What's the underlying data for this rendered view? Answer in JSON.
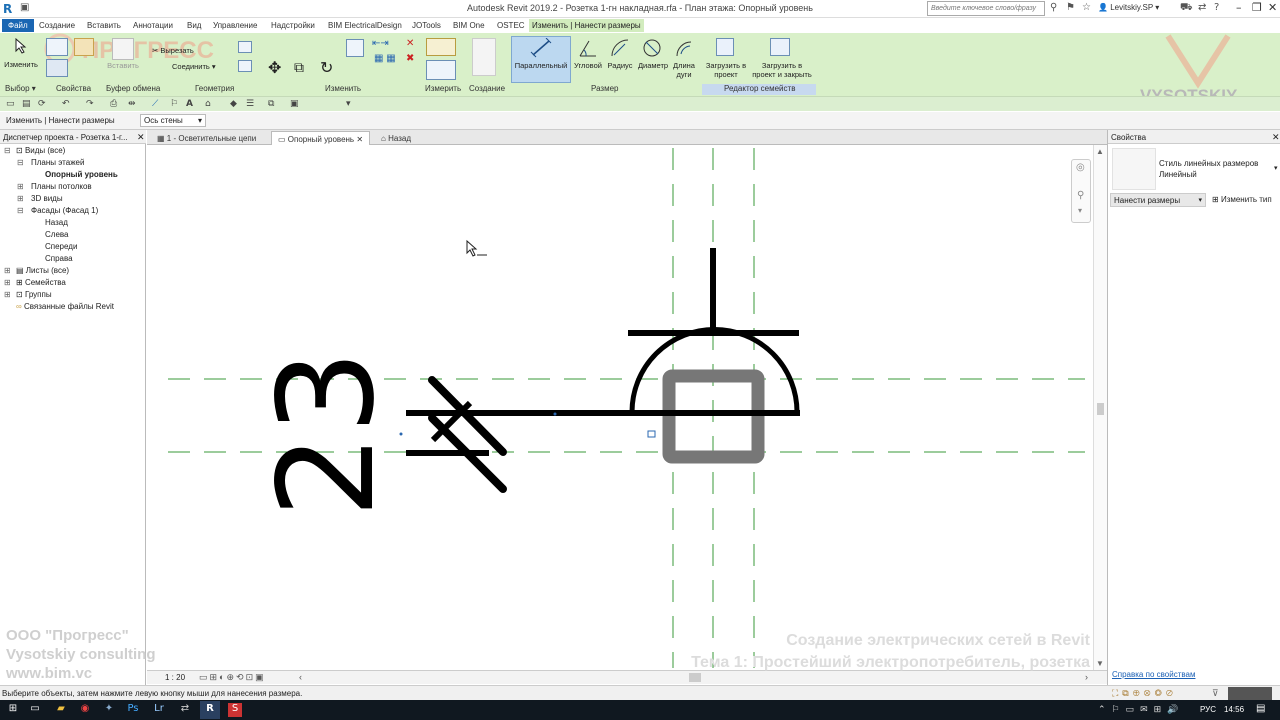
{
  "app": {
    "window_title": "Autodesk Revit 2019.2 - Розетка 1-гн накладная.rfa - План этажа: Опорный уровень",
    "search_placeholder": "Введите ключевое слово/фразу",
    "user": "Levitskiy.SP"
  },
  "ribbon_tabs": [
    {
      "label": "Файл"
    },
    {
      "label": "Создание"
    },
    {
      "label": "Вставить"
    },
    {
      "label": "Аннотации"
    },
    {
      "label": "Вид"
    },
    {
      "label": "Управление"
    },
    {
      "label": "Надстройки"
    },
    {
      "label": "BIM ElectricalDesign"
    },
    {
      "label": "JOTools"
    },
    {
      "label": "BIM One"
    },
    {
      "label": "OSTEC"
    },
    {
      "label": "Изменить | Нанести размеры"
    }
  ],
  "ribbon": {
    "modify_label": "Изменить",
    "paste_label": "Вставить",
    "cut_label": "Вырезать",
    "join_label": "Соединить",
    "dim_buttons": [
      {
        "label": "Параллельный"
      },
      {
        "label": "Угловой"
      },
      {
        "label": "Радиус"
      },
      {
        "label": "Диаметр"
      },
      {
        "label": "Длина дуги"
      }
    ],
    "load_label": "Загрузить в проект",
    "load_close_label": "Загрузить в проект и закрыть",
    "panels": {
      "select": "Выбор",
      "properties": "Свойства",
      "clipboard": "Буфер обмена",
      "geometry": "Геометрия",
      "modify": "Изменить",
      "measure": "Измерить",
      "create": "Создание",
      "dimension": "Размер",
      "family_editor": "Редактор семейств"
    }
  },
  "options_bar": {
    "context": "Изменить | Нанести размеры",
    "reference": "Ось стены"
  },
  "browser": {
    "title": "Диспетчер проекта - Розетка 1-г...",
    "items": [
      {
        "label": "Виды (все)"
      },
      {
        "label": "Планы этажей"
      },
      {
        "label": "Опорный уровень"
      },
      {
        "label": "Планы потолков"
      },
      {
        "label": "3D виды"
      },
      {
        "label": "Фасады (Фасад 1)"
      },
      {
        "label": "Назад"
      },
      {
        "label": "Слева"
      },
      {
        "label": "Спереди"
      },
      {
        "label": "Справа"
      },
      {
        "label": "Листы (все)"
      },
      {
        "label": "Семейства"
      },
      {
        "label": "Группы"
      },
      {
        "label": "Связанные файлы Revit"
      }
    ]
  },
  "view_tabs": [
    {
      "label": "1 - Осветительные цепи"
    },
    {
      "label": "Опорный уровень"
    },
    {
      "label": "Назад"
    }
  ],
  "canvas": {
    "symbol_text": "23"
  },
  "view_bar": {
    "scale": "1 : 20"
  },
  "properties": {
    "title": "Свойства",
    "type_name": "Стиль линейных размеров",
    "type_sub": "Линейный",
    "filter": "Нанести размеры",
    "edit_type": "Изменить тип",
    "help_link": "Справка по свойствам"
  },
  "status": {
    "message": "Выберите объекты, затем нажмите левую кнопку мыши для нанесения размера."
  },
  "watermark": {
    "company1": "ООО \"Прогресс\"",
    "company2": "Vysotskiy consulting",
    "site": "www.bim.vc",
    "course_title": "Создание электрических сетей в Revit",
    "topic": "Тема 1: Простейший электропотребитель, розетка",
    "brand_top": "ПРОГРЕСС",
    "brand_right": "VYSOTSKIY"
  },
  "taskbar": {
    "lang": "РУС",
    "time": "14:56"
  }
}
